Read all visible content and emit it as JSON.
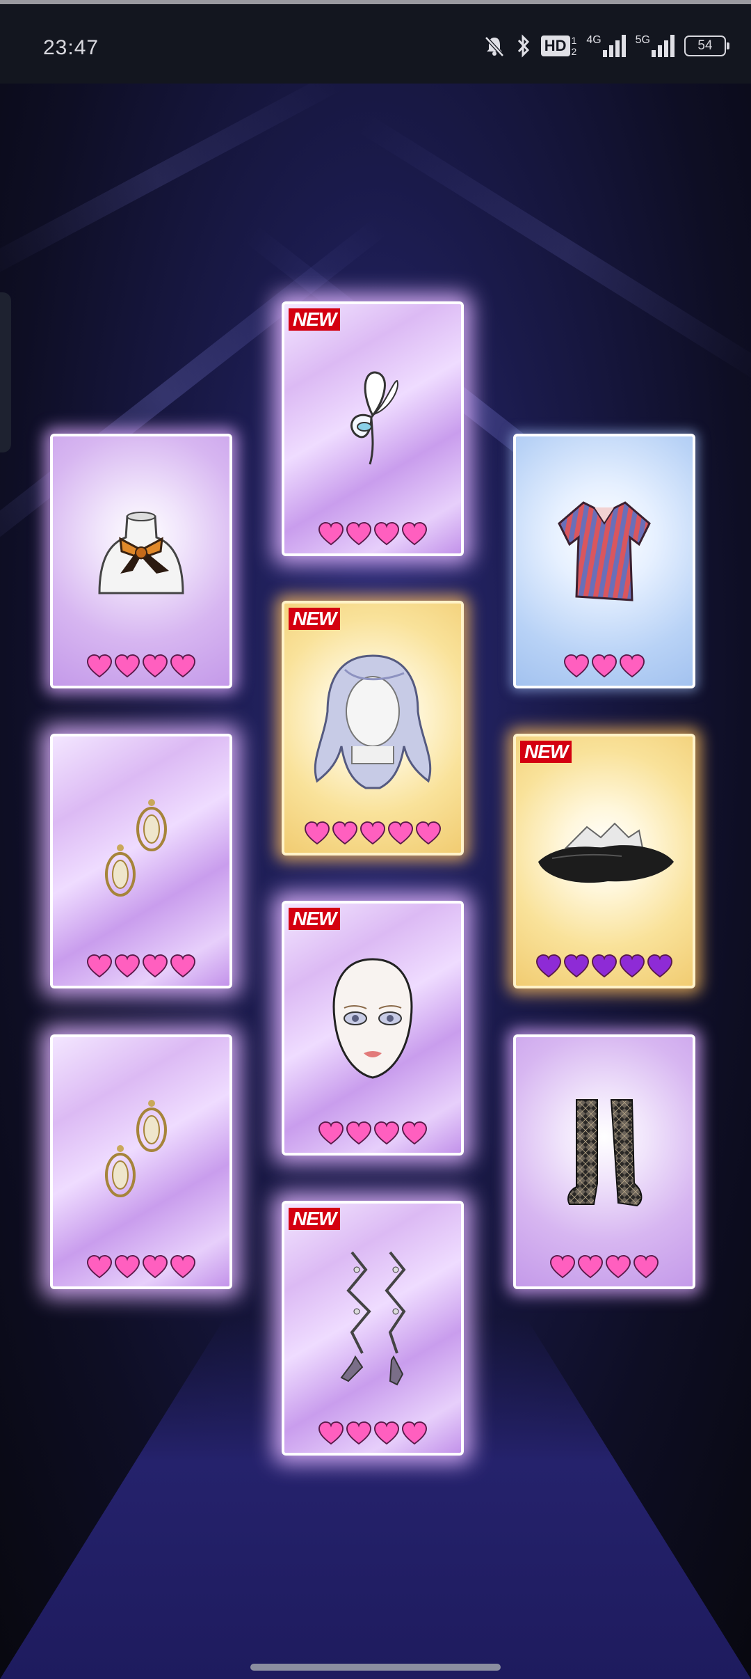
{
  "status_bar": {
    "time": "23:47",
    "icons": [
      "mute-bell-icon",
      "bluetooth-icon",
      "hd-icon",
      "signal-4g-icon",
      "signal-5g-icon",
      "battery-icon"
    ],
    "hd_label": "HD",
    "hd_sub": "1\n2",
    "net1": "4G",
    "net2": "5G",
    "battery": "54"
  },
  "colors": {
    "heart_pink": "#ff5fbf",
    "heart_purple": "#8e2bd6",
    "new_badge": "#d40010"
  },
  "cards": [
    {
      "id": "scarf",
      "item": "silk-scarf",
      "rarity_hearts": 4,
      "heart_color": "pink",
      "is_new": false
    },
    {
      "id": "butterfly",
      "item": "butterfly-hairpin",
      "rarity_hearts": 4,
      "heart_color": "pink",
      "is_new": true,
      "badge": "NEW"
    },
    {
      "id": "shirt",
      "item": "striped-shirt",
      "rarity_hearts": 3,
      "heart_color": "pink",
      "is_new": false
    },
    {
      "id": "earrings1",
      "item": "oval-earrings",
      "rarity_hearts": 4,
      "heart_color": "pink",
      "is_new": false
    },
    {
      "id": "hair",
      "item": "long-silver-hair",
      "rarity_hearts": 5,
      "heart_color": "pink",
      "is_new": true,
      "badge": "NEW"
    },
    {
      "id": "ground",
      "item": "dark-floor-effect",
      "rarity_hearts": 5,
      "heart_color": "purple",
      "is_new": true,
      "badge": "NEW"
    },
    {
      "id": "earrings2",
      "item": "oval-earrings",
      "rarity_hearts": 4,
      "heart_color": "pink",
      "is_new": false
    },
    {
      "id": "makeup",
      "item": "face-makeup",
      "rarity_hearts": 4,
      "heart_color": "pink",
      "is_new": true,
      "badge": "NEW"
    },
    {
      "id": "socks",
      "item": "argyle-socks",
      "rarity_hearts": 4,
      "heart_color": "pink",
      "is_new": false
    },
    {
      "id": "heels",
      "item": "lace-up-heels",
      "rarity_hearts": 4,
      "heart_color": "pink",
      "is_new": true,
      "badge": "NEW"
    }
  ]
}
